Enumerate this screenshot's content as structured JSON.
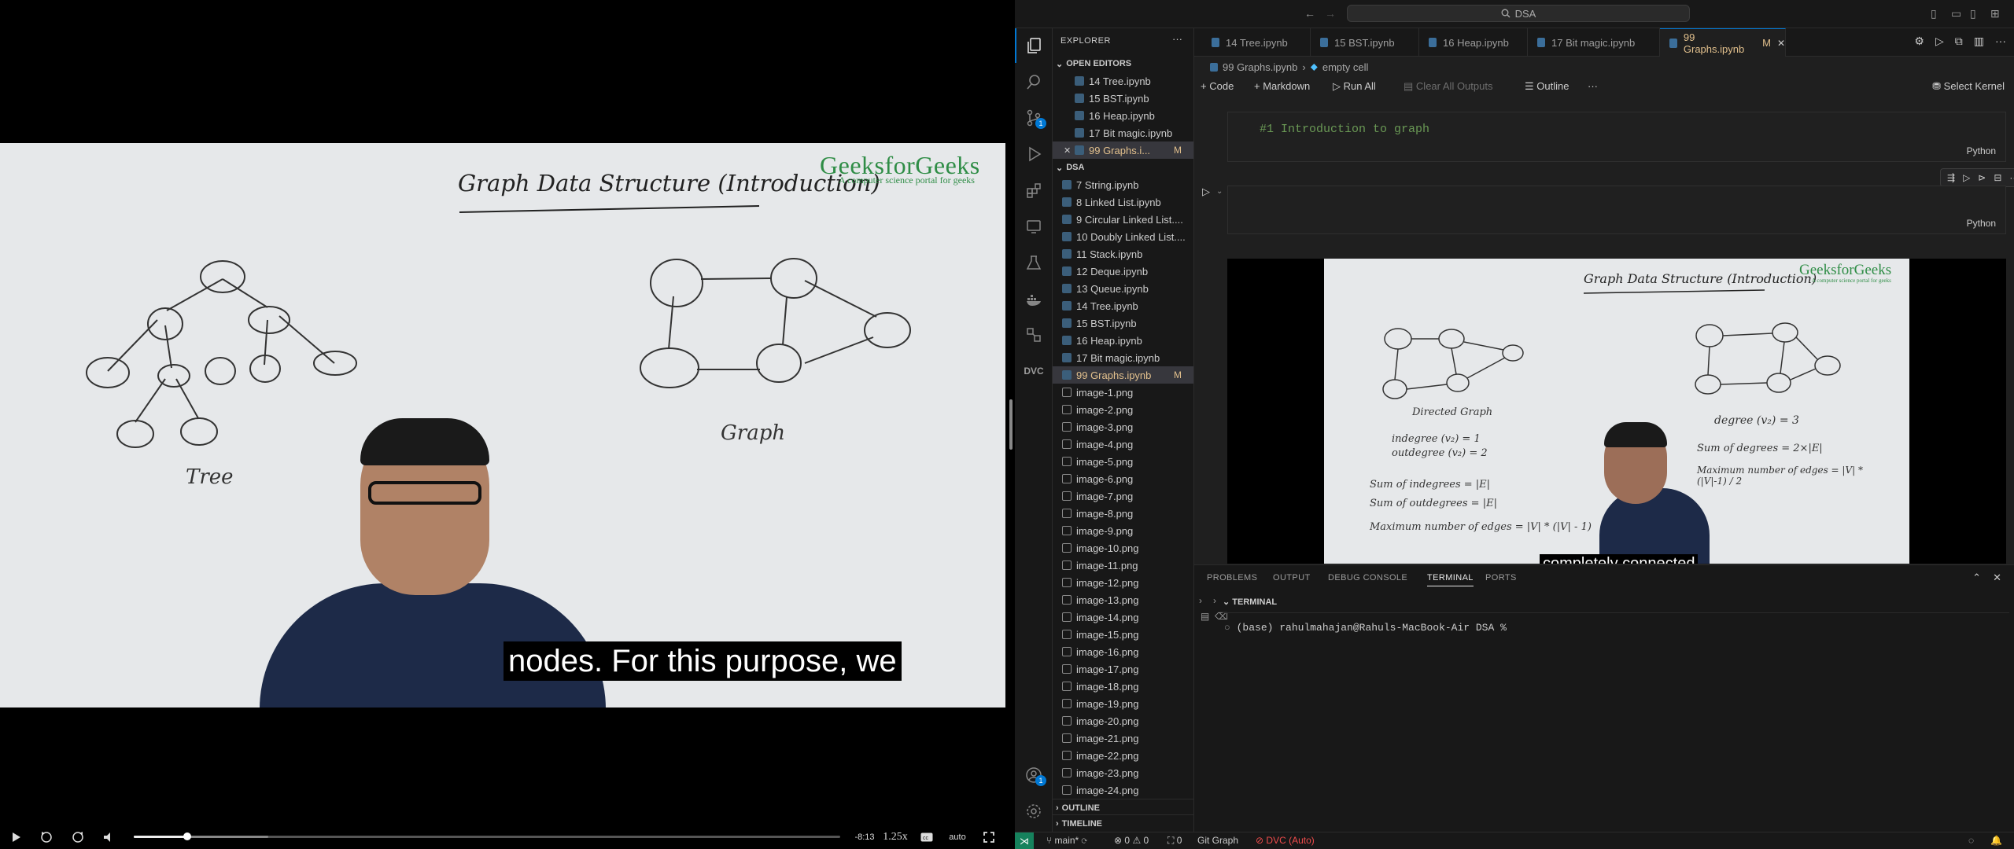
{
  "video": {
    "slide_title": "Graph Data Structure (Introduction)",
    "brand": "GeeksforGeeks",
    "brand_tagline": "A computer science portal for geeks",
    "tree_label": "Tree",
    "graph_label": "Graph",
    "subtitle": "nodes. For this purpose, we",
    "time_remaining": "-8:13",
    "speed": "1.25x",
    "quality": "auto",
    "progress_fraction": 0.076,
    "buffer_fraction": 0.19
  },
  "titlebar": {
    "search_text": "DSA"
  },
  "sidebar": {
    "title": "EXPLORER",
    "open_editors_label": "OPEN EDITORS",
    "open_editors": [
      {
        "name": "14 Tree.ipynb"
      },
      {
        "name": "15 BST.ipynb"
      },
      {
        "name": "16 Heap.ipynb"
      },
      {
        "name": "17 Bit magic.ipynb"
      },
      {
        "name": "99 Graphs.i...",
        "flag": "M"
      }
    ],
    "folder_label": "DSA",
    "files": [
      {
        "name": "7 String.ipynb",
        "type": "nb"
      },
      {
        "name": "8 Linked List.ipynb",
        "type": "nb"
      },
      {
        "name": "9 Circular Linked List....",
        "type": "nb"
      },
      {
        "name": "10 Doubly Linked List....",
        "type": "nb"
      },
      {
        "name": "11 Stack.ipynb",
        "type": "nb"
      },
      {
        "name": "12 Deque.ipynb",
        "type": "nb"
      },
      {
        "name": "13 Queue.ipynb",
        "type": "nb"
      },
      {
        "name": "14 Tree.ipynb",
        "type": "nb"
      },
      {
        "name": "15 BST.ipynb",
        "type": "nb"
      },
      {
        "name": "16 Heap.ipynb",
        "type": "nb"
      },
      {
        "name": "17 Bit magic.ipynb",
        "type": "nb"
      },
      {
        "name": "99 Graphs.ipynb",
        "type": "nb",
        "flag": "M"
      },
      {
        "name": "image-1.png",
        "type": "img"
      },
      {
        "name": "image-2.png",
        "type": "img"
      },
      {
        "name": "image-3.png",
        "type": "img"
      },
      {
        "name": "image-4.png",
        "type": "img"
      },
      {
        "name": "image-5.png",
        "type": "img"
      },
      {
        "name": "image-6.png",
        "type": "img"
      },
      {
        "name": "image-7.png",
        "type": "img"
      },
      {
        "name": "image-8.png",
        "type": "img"
      },
      {
        "name": "image-9.png",
        "type": "img"
      },
      {
        "name": "image-10.png",
        "type": "img"
      },
      {
        "name": "image-11.png",
        "type": "img"
      },
      {
        "name": "image-12.png",
        "type": "img"
      },
      {
        "name": "image-13.png",
        "type": "img"
      },
      {
        "name": "image-14.png",
        "type": "img"
      },
      {
        "name": "image-15.png",
        "type": "img"
      },
      {
        "name": "image-16.png",
        "type": "img"
      },
      {
        "name": "image-17.png",
        "type": "img"
      },
      {
        "name": "image-18.png",
        "type": "img"
      },
      {
        "name": "image-19.png",
        "type": "img"
      },
      {
        "name": "image-20.png",
        "type": "img"
      },
      {
        "name": "image-21.png",
        "type": "img"
      },
      {
        "name": "image-22.png",
        "type": "img"
      },
      {
        "name": "image-23.png",
        "type": "img"
      },
      {
        "name": "image-24.png",
        "type": "img"
      }
    ],
    "outline_label": "OUTLINE",
    "timeline_label": "TIMELINE"
  },
  "activity": {
    "scm_badge": "1",
    "settings_badge": "1"
  },
  "tabs": [
    {
      "label": "14 Tree.ipynb"
    },
    {
      "label": "15 BST.ipynb"
    },
    {
      "label": "16 Heap.ipynb"
    },
    {
      "label": "17 Bit magic.ipynb"
    },
    {
      "label": "99 Graphs.ipynb",
      "flag": "M"
    }
  ],
  "breadcrumb": {
    "file": "99 Graphs.ipynb",
    "cell": "empty cell"
  },
  "nb_toolbar": {
    "code": "Code",
    "markdown": "Markdown",
    "run_all": "Run All",
    "clear": "Clear All Outputs",
    "outline": "Outline",
    "kernel": "Select Kernel"
  },
  "cells": {
    "md_text": "#1 Introduction to graph",
    "lang": "Python"
  },
  "output_video": {
    "title": "Graph Data Structure (Introduction)",
    "brand": "GeeksforGeeks",
    "tagline": "A computer science portal for geeks",
    "directed_label": "Directed Graph",
    "indegree": "indegree (v₂) = 1",
    "outdegree": "outdegree (v₂) = 2",
    "sum_in": "Sum of indegrees = |E|",
    "sum_out": "Sum of outdegrees = |E|",
    "max_edges_dir": "Maximum number of edges = |V| * (|V| - 1)",
    "degree": "degree (v₂) = 3",
    "sum_deg": "Sum of degrees = 2×|E|",
    "max_edges_undir": "Maximum number of edges = |V| * (|V|-1) / 2",
    "subtitle": "completely connected"
  },
  "panel": {
    "tabs": [
      "PROBLEMS",
      "OUTPUT",
      "DEBUG CONSOLE",
      "TERMINAL",
      "PORTS"
    ],
    "active_tab": "TERMINAL",
    "terminal_title": "TERMINAL",
    "prompt": "(base) rahulmahajan@Rahuls-MacBook-Air DSA %"
  },
  "statusbar": {
    "branch": "main*",
    "errors": "0",
    "warnings": "0",
    "ports": "0",
    "git_graph": "Git Graph",
    "dvc": "DVC (Auto)"
  },
  "colors": {
    "accent": "#0078d4",
    "modified": "#e2c08d",
    "brand_green": "#2f8d46",
    "dvc_red": "#f14c4c"
  }
}
